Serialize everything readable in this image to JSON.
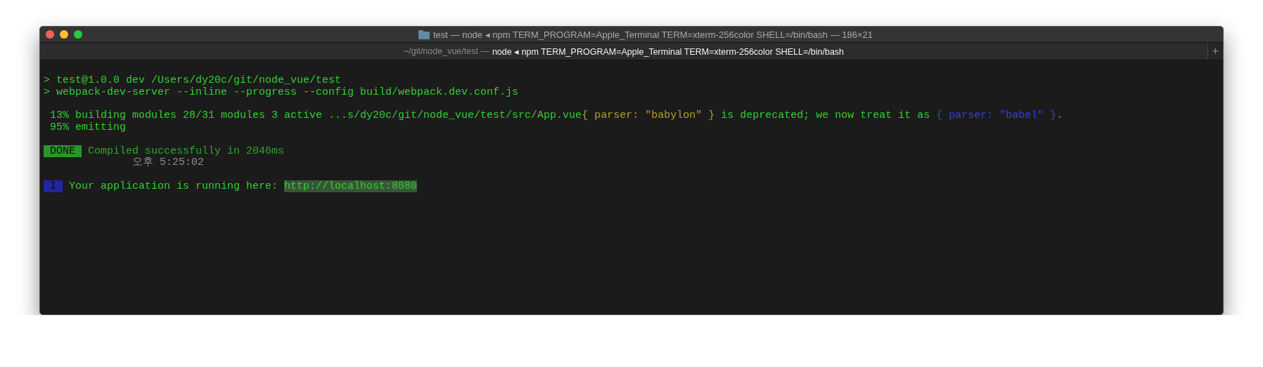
{
  "window": {
    "title": "test — node ◂ npm TERM_PROGRAM=Apple_Terminal TERM=xterm-256color SHELL=/bin/bash — 186×21"
  },
  "tab": {
    "path": "~/git/node_vue/test —",
    "command": "node ◂ npm TERM_PROGRAM=Apple_Terminal TERM=xterm-256color SHELL=/bin/bash",
    "selected": true
  },
  "new_tab_button": "+",
  "blocks": [
    {
      "lines": [
        {
          "segments": [
            {
              "kind": "text",
              "text": "> test@1.0.0 dev /Users/dy20c/git/node_vue/test",
              "color": "#33d033"
            }
          ]
        },
        {
          "segments": [
            {
              "kind": "text",
              "text": "> webpack-dev-server --inline --progress --config build/webpack.dev.conf.js",
              "color": "#33d033"
            }
          ]
        }
      ]
    },
    {
      "lines": [
        {
          "segments": [
            {
              "kind": "text",
              "text": " 13% building modules 28/31 modules 3 active ...s/dy20c/git/node_vue/test/src/App.vue",
              "color": "#33d033"
            },
            {
              "kind": "text",
              "text": "{ parser: \"babylon\" }",
              "color": "#b0a02a"
            },
            {
              "kind": "text",
              "text": " is deprecated; we now treat it as ",
              "color": "#33d033"
            },
            {
              "kind": "text",
              "text": "{ parser: \"babel\" }",
              "color": "#3d3dd8"
            },
            {
              "kind": "text",
              "text": "."
            }
          ]
        },
        {
          "segments": [
            {
              "kind": "text",
              "text": " 95% emitting",
              "color": "#33d033"
            }
          ]
        }
      ]
    },
    {
      "lines": [
        {
          "segments": [
            {
              "kind": "badge",
              "text": " DONE ",
              "color": "#2a962a"
            },
            {
              "kind": "text",
              "text": " Compiled successfully in 2046ms",
              "color": "#2fa52f"
            }
          ]
        },
        {
          "segments": [
            {
              "kind": "text",
              "text": "              오후 5:25:02",
              "color": "#8c8c8c"
            }
          ]
        }
      ]
    },
    {
      "lines": [
        {
          "segments": [
            {
              "kind": "badge",
              "text": " I ",
              "color": "#2323a8"
            },
            {
              "kind": "text",
              "text": " Your application is running here: ",
              "color": "#33d033"
            },
            {
              "kind": "link",
              "text": "http://localhost:8080"
            }
          ]
        }
      ]
    }
  ]
}
